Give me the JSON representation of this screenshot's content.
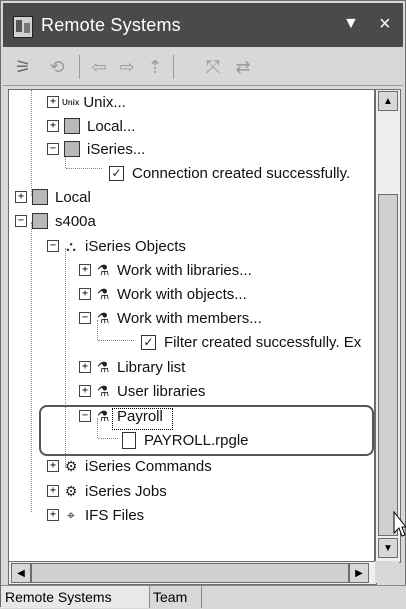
{
  "window": {
    "title": "Remote Systems",
    "menu_icon": "view-menu-icon",
    "close_label": "×"
  },
  "toolbar": {
    "icons": [
      "define-connection-icon",
      "refresh-icon",
      "back-icon",
      "forward-icon",
      "up-icon",
      "collapse-all-icon",
      "link-with-editor-icon"
    ]
  },
  "tree": {
    "unix_tag": "Unix",
    "unix": "Unix...",
    "local_top": "Local...",
    "iseries_top": "iSeries...",
    "connection_msg": "Connection created successfully.",
    "local": "Local",
    "s400a": "s400a",
    "iseries_objects": "iSeries Objects",
    "work_libraries": "Work with libraries...",
    "work_objects": "Work with objects...",
    "work_members": "Work with members...",
    "filter_msg": "Filter created successfully. Ex",
    "library_list": "Library list",
    "user_libraries": "User libraries",
    "payroll": "Payroll",
    "payroll_rpgle": "PAYROLL.rpgle",
    "iseries_commands": "iSeries Commands",
    "iseries_jobs": "iSeries Jobs",
    "ifs_files": "IFS Files"
  },
  "tabs": [
    {
      "label": "Remote Systems",
      "active": true
    },
    {
      "label": "Team",
      "active": false
    }
  ]
}
